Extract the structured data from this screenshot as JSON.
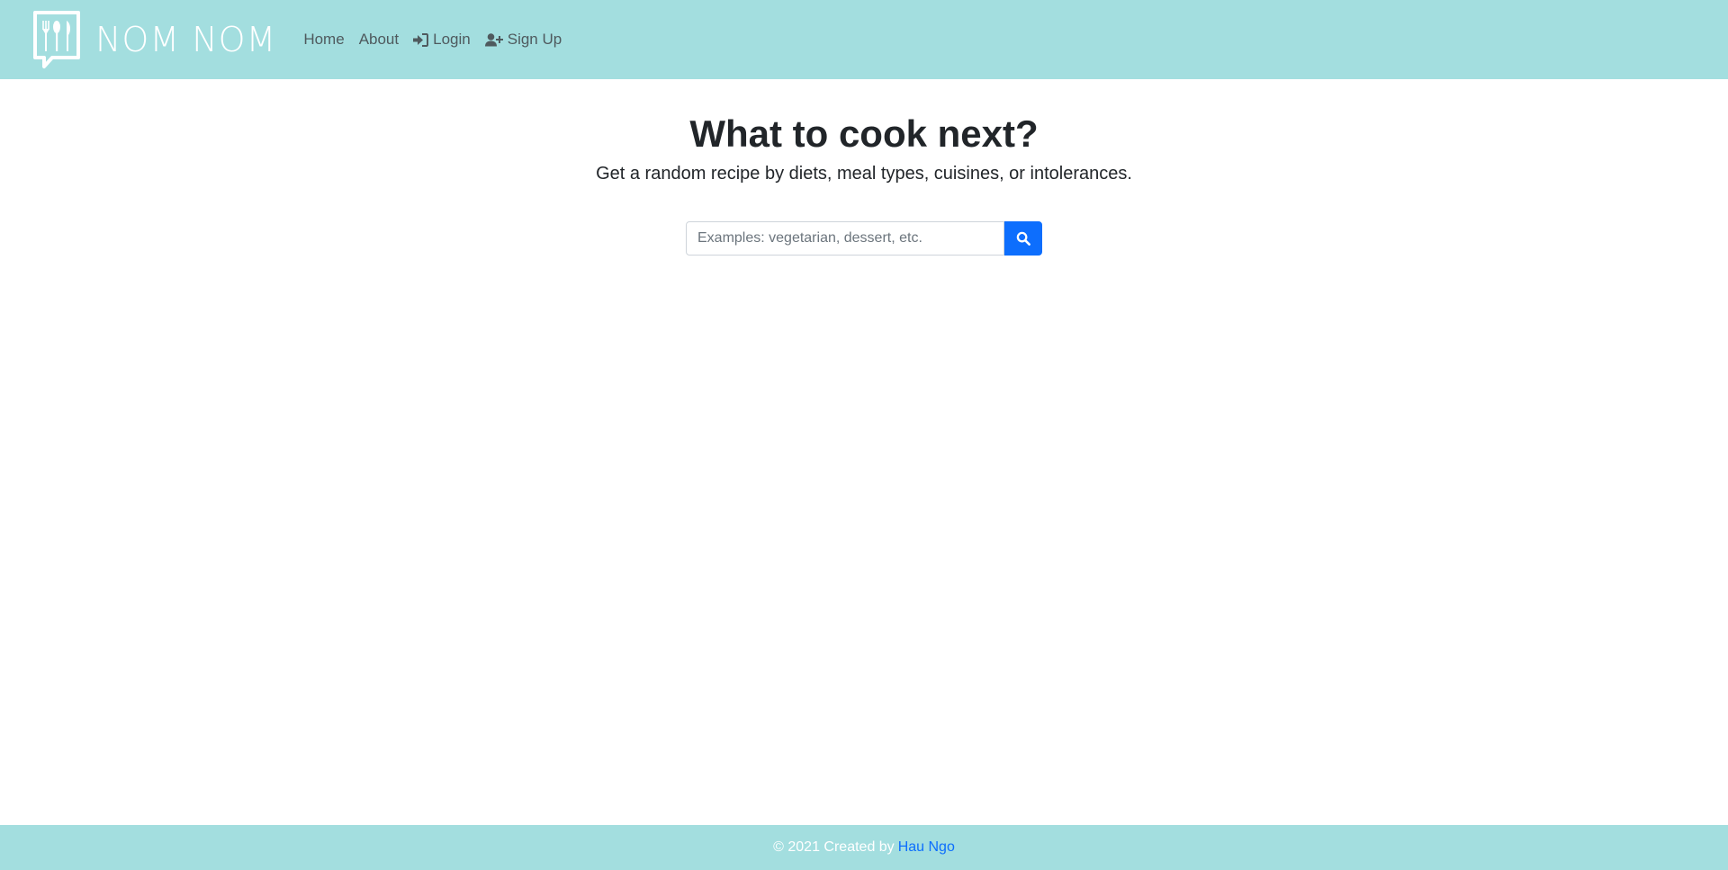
{
  "brand": {
    "name": "NOM NOM",
    "logo_icon": "utensils-logo-icon"
  },
  "nav": {
    "items": [
      {
        "label": "Home",
        "icon": ""
      },
      {
        "label": "About",
        "icon": ""
      },
      {
        "label": "Login",
        "icon": "sign-in-icon"
      },
      {
        "label": "Sign Up",
        "icon": "user-plus-icon"
      }
    ]
  },
  "hero": {
    "title": "What to cook next?",
    "subtitle": "Get a random recipe by diets, meal types, cuisines, or intolerances."
  },
  "search": {
    "placeholder": "Examples: vegetarian, dessert, etc.",
    "value": "",
    "button_icon": "search-icon"
  },
  "footer": {
    "text": "© 2021 Created by",
    "author": "Hau Ngo"
  },
  "colors": {
    "header_bg": "#a3dedf",
    "primary": "#0d6efd",
    "nav_text": "#4f5a5e"
  }
}
